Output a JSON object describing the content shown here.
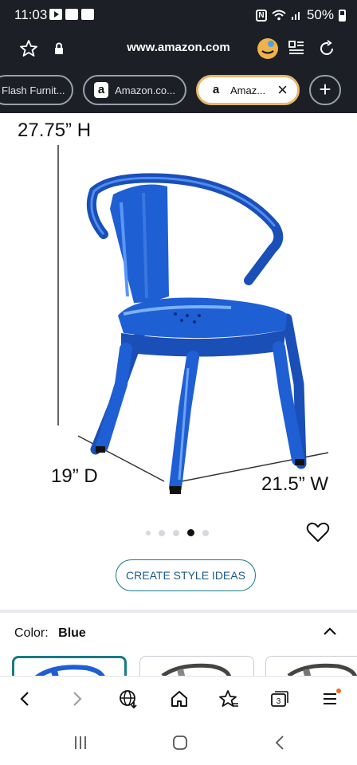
{
  "status": {
    "time": "11:03",
    "battery": "50%"
  },
  "browser": {
    "url": "www.amazon.com",
    "tabs": [
      {
        "label": "Flash Furnit..."
      },
      {
        "label": "Amazon.co..."
      },
      {
        "label": "Amaz..."
      }
    ],
    "tab_logo": "a",
    "tab_count": "3"
  },
  "product": {
    "dimensions": {
      "height": "27.75” H",
      "depth": "19” D",
      "width": "21.5” W"
    },
    "image_dots": {
      "count": 5,
      "active": 3
    },
    "style_button": "CREATE STYLE IDEAS",
    "color_label": "Color:",
    "color_value": "Blue"
  },
  "colors": {
    "chair": "#1f5fd4",
    "accent": "#1a7a85",
    "dark": "#1c1f26",
    "tab_highlight": "#e8b76a"
  }
}
